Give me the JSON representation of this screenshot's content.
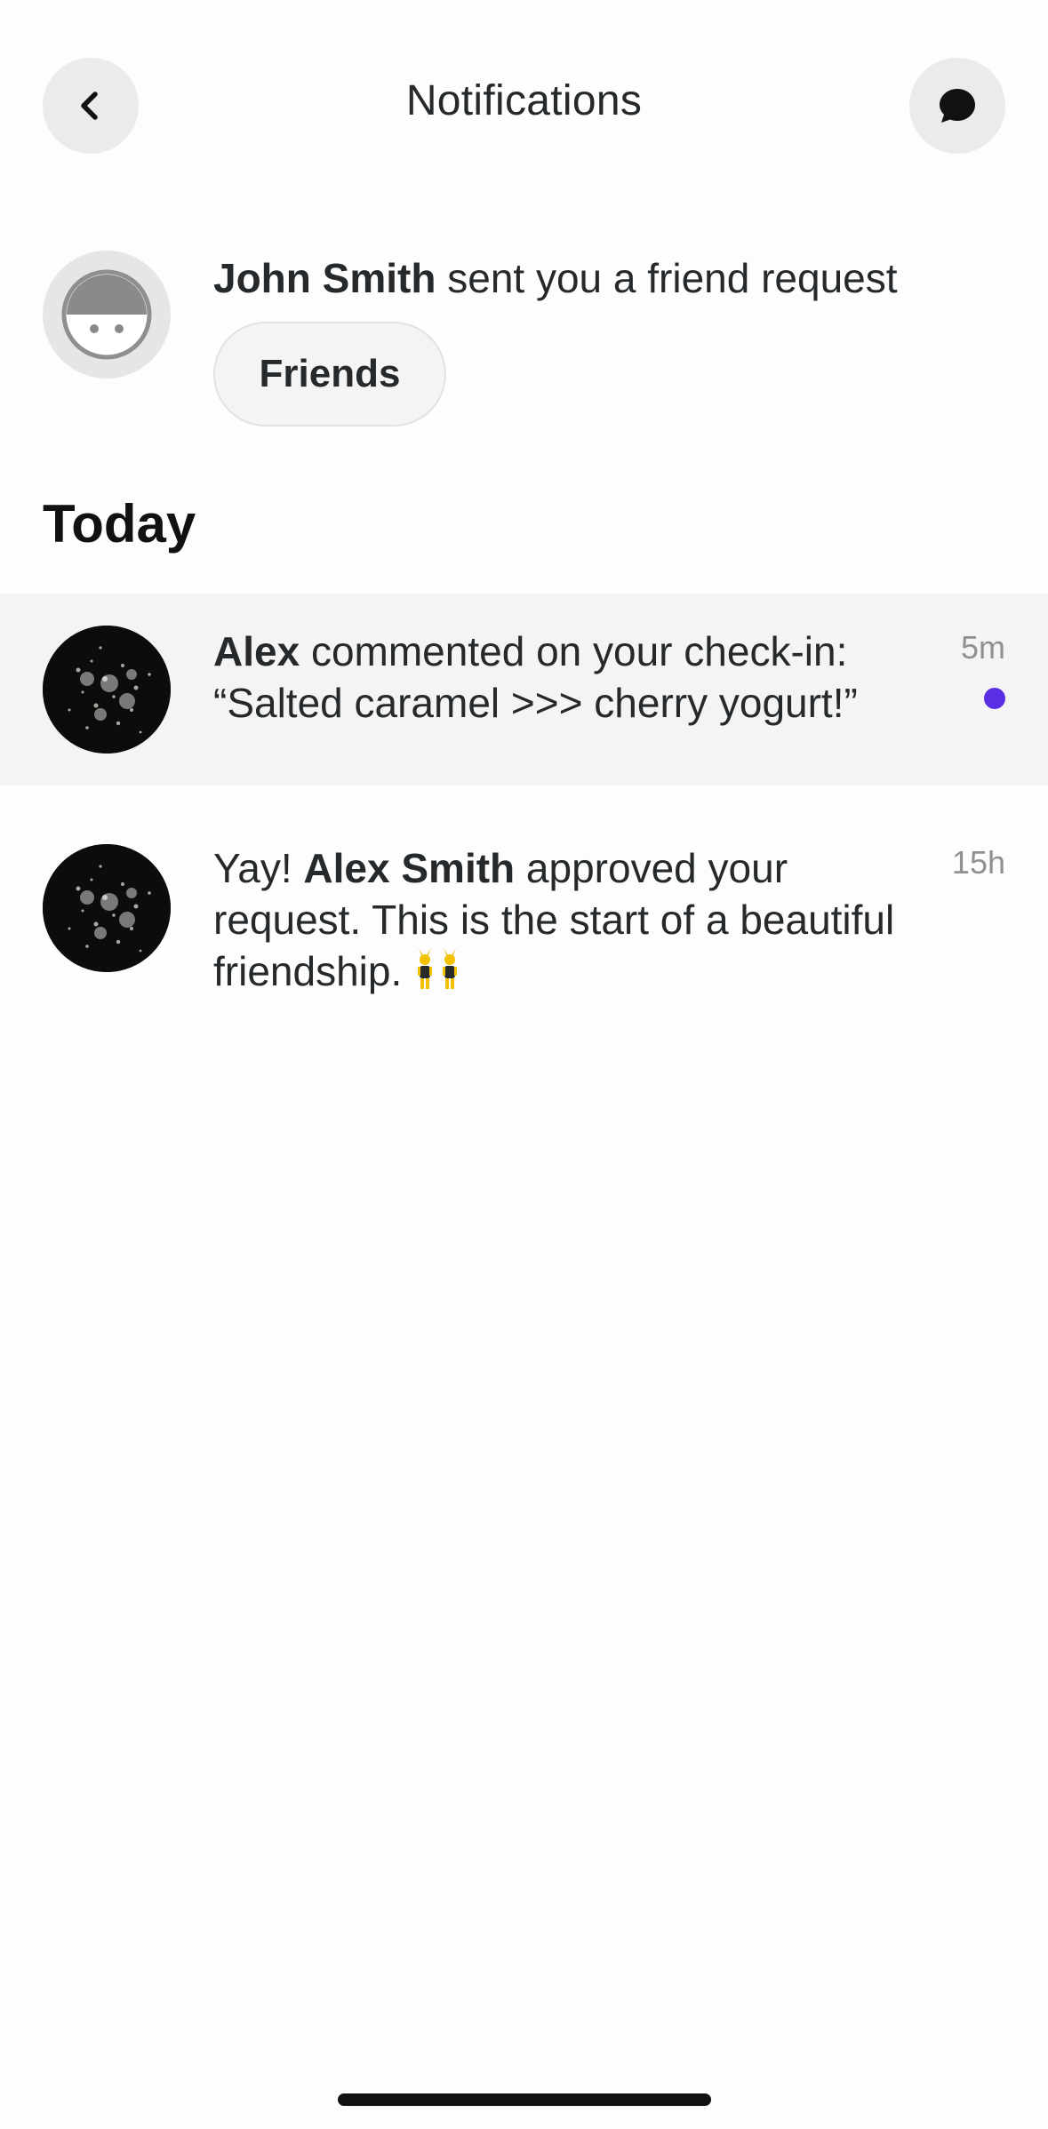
{
  "header": {
    "title": "Notifications",
    "back_icon": "chevron-left-icon",
    "chat_icon": "chat-bubble-icon"
  },
  "friend_request": {
    "name": "John Smith",
    "message": " sent you a friend request",
    "button_label": "Friends"
  },
  "section": {
    "title": "Today"
  },
  "notifications": [
    {
      "name": "Alex",
      "text_line1": " commented on your check-in:",
      "text_line2": "“Salted caramel >>> cherry yogurt!”",
      "time": "5m",
      "unread": true
    },
    {
      "prefix": "Yay! ",
      "name": "Alex Smith",
      "text": " approved your request. This is the start of a beautiful friendship.",
      "time": "15h",
      "unread": false
    }
  ],
  "colors": {
    "accent_unread": "#5b2ee6",
    "highlight_row": "#f4f4f4",
    "button_bg": "#ebebeb"
  }
}
